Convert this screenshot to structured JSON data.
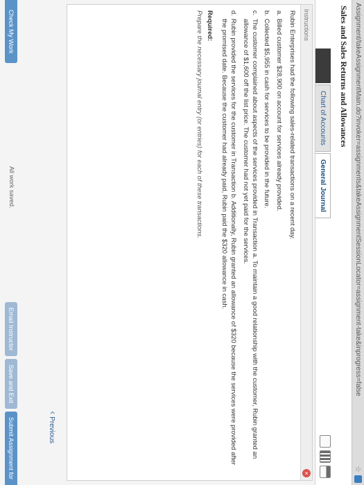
{
  "browser": {
    "url": "Assignment/takeAssignmentMain.do?invoker=assignments&takeAssignmentSessionLocator=assignment-take&inprogress=false"
  },
  "header": {
    "title": "Sales and Sales Returns and Allowances",
    "tabs": [
      {
        "label": ""
      },
      {
        "label": "Chart of Accounts"
      },
      {
        "label": "General Journal"
      }
    ]
  },
  "instructions": {
    "bar_label": "Instructions",
    "intro": "Rubin Enterprises had the following sales-related transactions on a recent day.",
    "items": [
      {
        "letter": "a.",
        "text": "Billed customer $28,900 on account for services already provided."
      },
      {
        "letter": "b.",
        "text": "Collected $5,955 in cash for services to be provided in the future."
      },
      {
        "letter": "c.",
        "text": "The customer complained about aspects of the services provided in Transaction a. To maintain a good relationship with the customer, Rubin granted an allowance of $1,600 off the list price. The customer had not yet paid for the services."
      },
      {
        "letter": "d.",
        "text": "Rubin provided the services for the customer in Transaction b. Additionally, Rubin granted an allowance of $320 because the services were provided after the promised date. Because the customer had already paid, Rubin paid the $320 allowance in cash."
      }
    ],
    "required_label": "Required:",
    "required_text": "Prepare the necessary journal entry (or entries) for each of these transactions."
  },
  "footer": {
    "previous_label": "Previous",
    "check_label": "Check My Work",
    "status": "All work saved.",
    "email_label": "Email Instructor",
    "save_label": "Save and Exit",
    "submit_label": "Submit Assignment for"
  }
}
